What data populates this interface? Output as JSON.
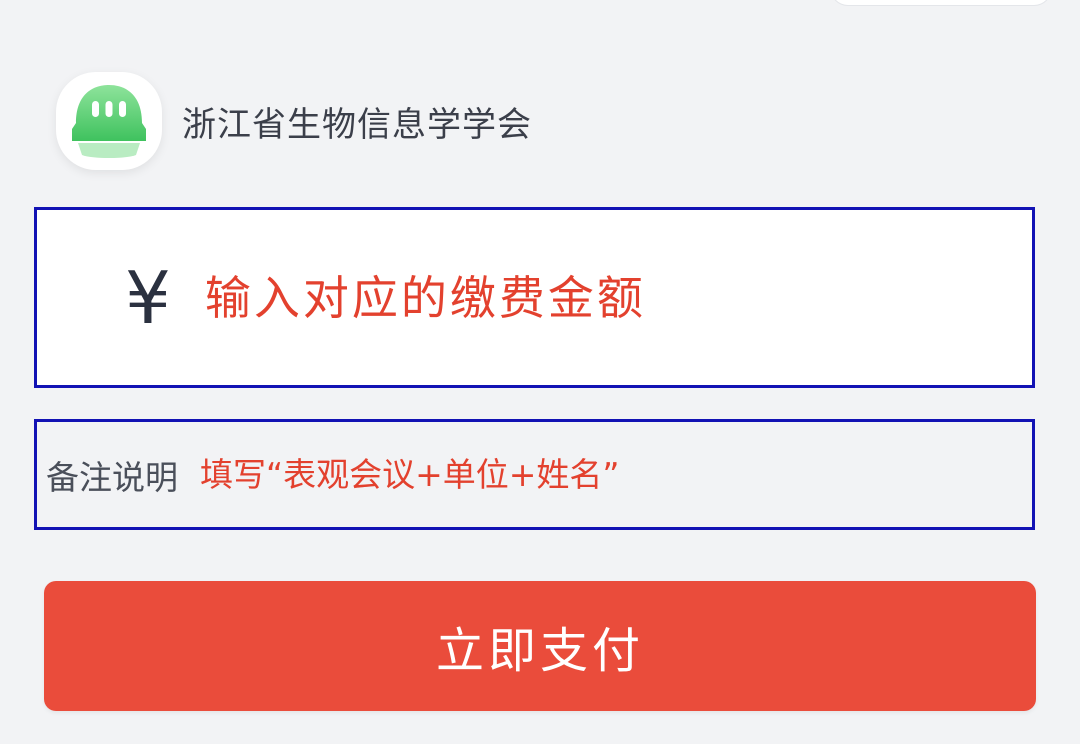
{
  "payee": {
    "name": "浙江省生物信息学学会",
    "avatar_icon": "bot-logo-icon",
    "avatar_color": "#5fd07a"
  },
  "amount": {
    "currency_symbol": "¥",
    "placeholder": "输入对应的缴费金额"
  },
  "remark": {
    "label": "备注说明",
    "placeholder": "填写“表观会议+单位+姓名”"
  },
  "actions": {
    "pay_label": "立即支付"
  },
  "colors": {
    "highlight_border": "#1212b4",
    "accent_red": "#ea4c3b",
    "hint_red": "#e3412e",
    "background": "#f2f3f5"
  }
}
